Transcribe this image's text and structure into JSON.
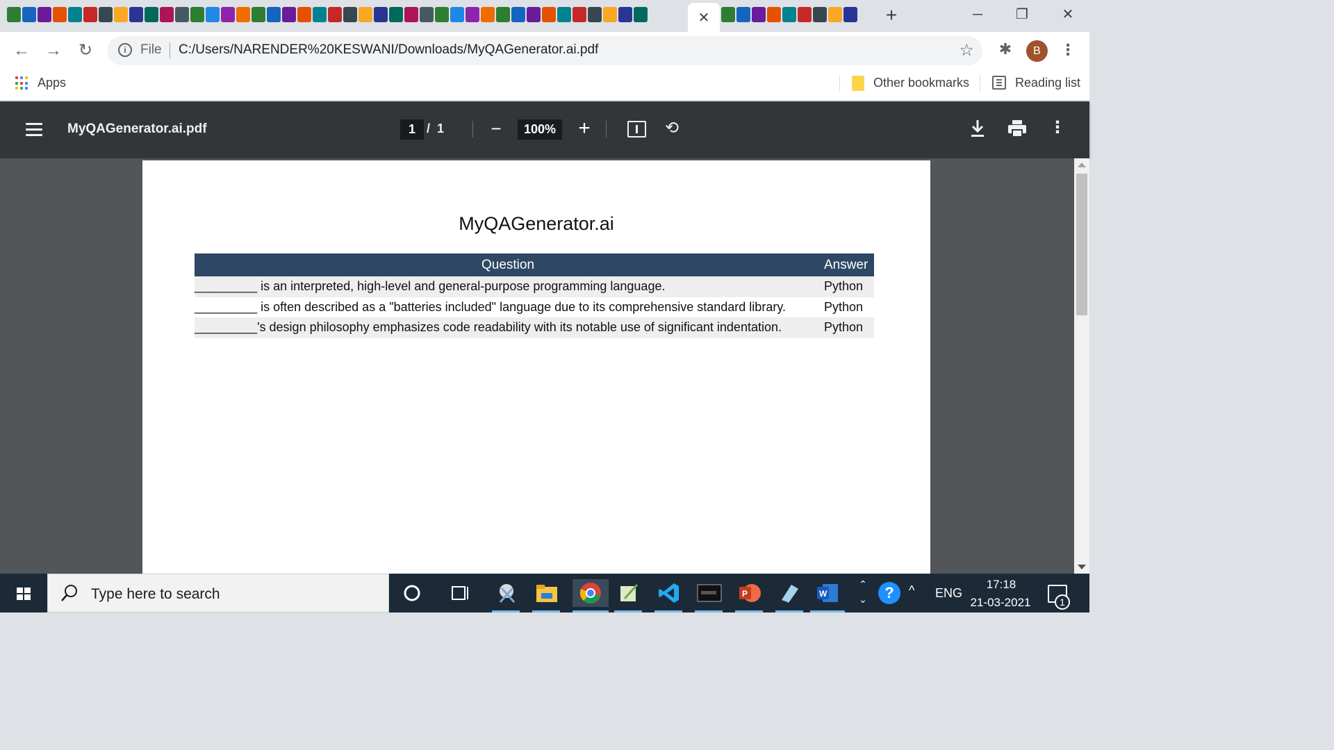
{
  "browser": {
    "tab_close_glyph": "✕",
    "new_tab_glyph": "+",
    "window_controls": {
      "minimize": "─",
      "restore": "❐",
      "close": "✕"
    },
    "toolbar": {
      "back_glyph": "←",
      "forward_glyph": "→",
      "reload_glyph": "↻",
      "info_glyph": "i",
      "scheme_label": "File",
      "url": "C:/Users/NARENDER%20KESWANI/Downloads/MyQAGenerator.ai.pdf",
      "star_glyph": "☆",
      "extensions_glyph": "✱",
      "avatar_letter": "B",
      "menu_glyph": "⋮"
    },
    "bookmarks": {
      "apps_label": "Apps",
      "other_bookmarks_label": "Other bookmarks",
      "reading_list_label": "Reading list"
    }
  },
  "pdf_viewer": {
    "file_name": "MyQAGenerator.ai.pdf",
    "current_page": "1",
    "page_separator": "/",
    "total_pages": "1",
    "zoom_minus_glyph": "−",
    "zoom_level": "100%",
    "zoom_plus_glyph": "+",
    "rotate_glyph": "⟲",
    "more_glyph": "⋮"
  },
  "document": {
    "title": "MyQAGenerator.ai",
    "table": {
      "headers": {
        "question": "Question",
        "answer": "Answer"
      },
      "rows": [
        {
          "question": "_________ is an interpreted, high-level and general-purpose programming language.",
          "answer": "Python"
        },
        {
          "question": "_________ is often described as a \"batteries included\" language due to its comprehensive standard library.",
          "answer": "Python"
        },
        {
          "question": "_________'s design philosophy emphasizes code readability with its notable use of significant indentation.",
          "answer": "Python"
        }
      ]
    }
  },
  "taskbar": {
    "search_placeholder": "Type here to search",
    "tray_up_glyph": "⌃",
    "tray_down_glyph": "⌄",
    "help_glyph": "?",
    "caret_glyph": "^",
    "language": "ENG",
    "time": "17:18",
    "date": "21-03-2021",
    "notification_count": "1"
  },
  "colors": {
    "pdf_toolbar_bg": "#323639",
    "viewer_bg": "#525659",
    "table_header_bg": "#2e4765",
    "table_stripe_bg": "#eeeeee",
    "taskbar_bg": "#1c2a38",
    "avatar_bg": "#a0522d"
  },
  "icons": {
    "tab_favicons": [
      "favicon-icon"
    ],
    "taskbar_apps": [
      "cortana-icon",
      "task-view-icon",
      "snipping-tool-icon",
      "file-explorer-icon",
      "chrome-icon",
      "notepad-icon",
      "vscode-icon",
      "mysql-icon",
      "powerpoint-icon",
      "paint-icon",
      "word-icon"
    ]
  }
}
